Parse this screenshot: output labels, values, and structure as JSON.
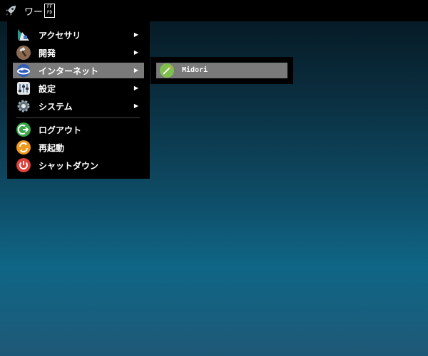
{
  "topbar": {
    "title": "ワー",
    "glyph_top": "FF",
    "glyph_bottom": "FD",
    "launcher_icon": "rocket-icon"
  },
  "menu": {
    "items": [
      {
        "label": "アクセサリ",
        "icon": "accessories-icon",
        "has_submenu": true
      },
      {
        "label": "開発",
        "icon": "hammer-icon",
        "has_submenu": true
      },
      {
        "label": "インターネット",
        "icon": "globe-icon",
        "has_submenu": true,
        "active": true
      },
      {
        "label": "設定",
        "icon": "settings-panel-icon",
        "has_submenu": true
      },
      {
        "label": "システム",
        "icon": "gear-icon",
        "has_submenu": true
      },
      {
        "label": "ログアウト",
        "icon": "logout-icon",
        "has_submenu": false
      },
      {
        "label": "再起動",
        "icon": "reboot-icon",
        "has_submenu": false
      },
      {
        "label": "シャットダウン",
        "icon": "power-icon",
        "has_submenu": false
      }
    ],
    "arrow": "▶"
  },
  "submenu": {
    "items": [
      {
        "label": "Midori",
        "icon": "midori-icon"
      }
    ]
  },
  "colors": {
    "menu_bg": "#000000",
    "highlight": "#7a7a7a",
    "logout_green": "#3aa74a",
    "reboot_orange": "#f29a1f",
    "power_red": "#e0413a"
  }
}
